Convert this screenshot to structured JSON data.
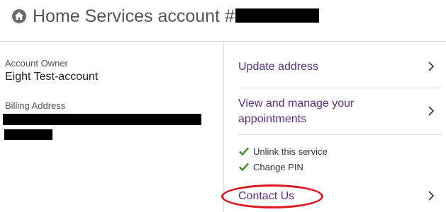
{
  "header": {
    "icon": "home-icon",
    "title": "Home Services account #"
  },
  "account": {
    "owner_label": "Account Owner",
    "owner_value": "Eight Test-account",
    "billing_label": "Billing Address"
  },
  "actions": {
    "update_address": "Update address",
    "manage_appointments_line1": "View and manage your",
    "manage_appointments_line2": "appointments",
    "unlink_service": "Unlink this service",
    "change_pin": "Change PIN",
    "contact_us": "Contact Us"
  },
  "colors": {
    "link": "#5a2d82",
    "check": "#4f8f2a",
    "annotation": "#e0141e"
  }
}
